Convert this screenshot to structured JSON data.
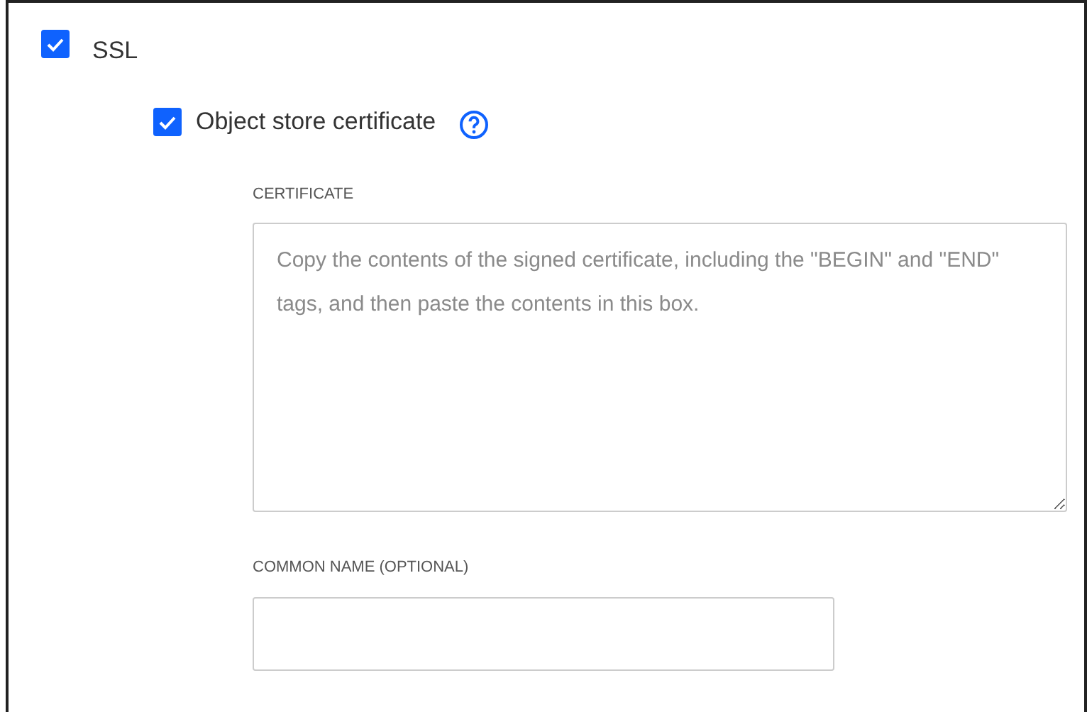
{
  "ssl": {
    "label": "SSL",
    "checked": true
  },
  "object_store_certificate": {
    "label": "Object store certificate",
    "checked": true
  },
  "certificate": {
    "label": "CERTIFICATE",
    "placeholder": "Copy the contents of the signed certificate, including the \"BEGIN\" and \"END\" tags, and then paste the contents in this box."
  },
  "common_name": {
    "label": "COMMON NAME (OPTIONAL)"
  }
}
